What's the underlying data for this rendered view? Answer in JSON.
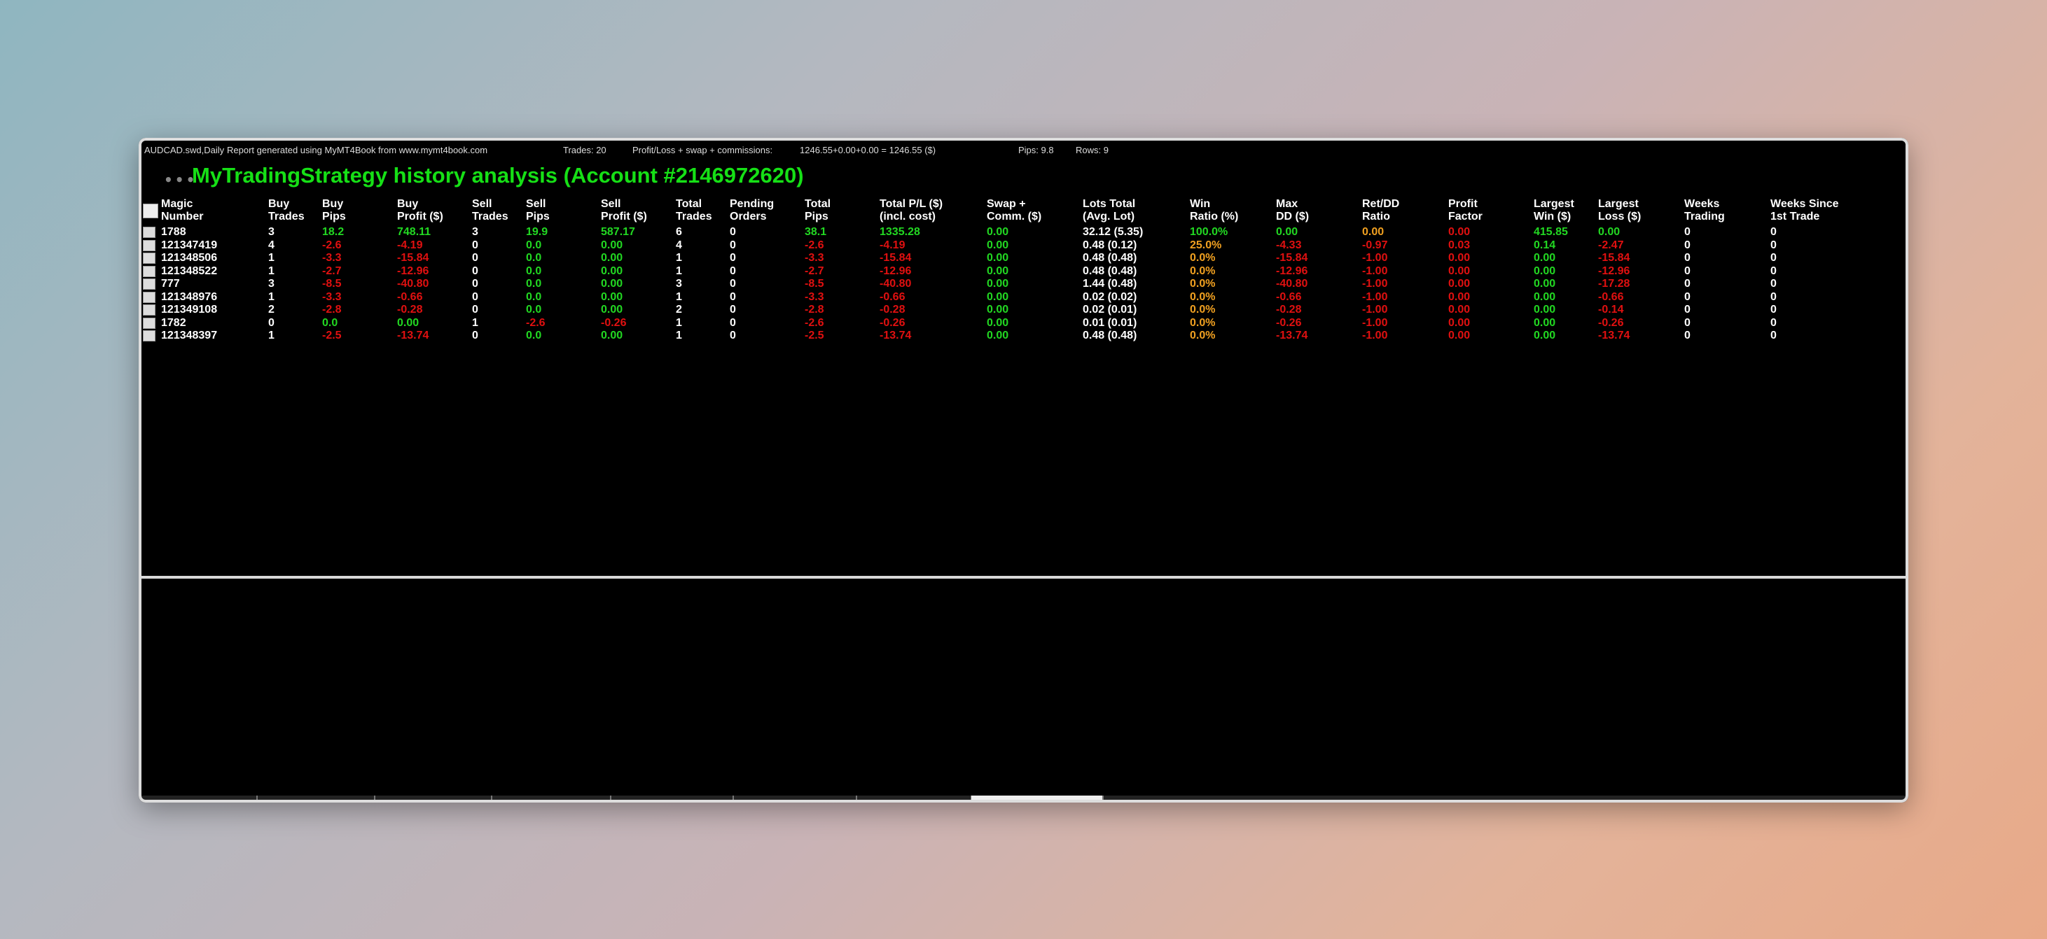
{
  "info": {
    "symbol": "AUDCAD.swd,Daily",
    "report": "Report generated using MyMT4Book from www.mymt4book.com",
    "trades": "Trades: 20",
    "pl_label": "Profit/Loss + swap + commissions:",
    "pl_value": "1246.55+0.00+0.00 = 1246.55 ($)",
    "pips": "Pips: 9.8",
    "rows": "Rows: 9"
  },
  "title": "MyTradingStrategy history analysis (Account #2146972620)",
  "dots": "•••",
  "headers": [
    [
      "Magic",
      "Number"
    ],
    [
      "Buy",
      "Trades"
    ],
    [
      "Buy",
      "Pips"
    ],
    [
      "Buy",
      "Profit ($)"
    ],
    [
      "Sell",
      "Trades"
    ],
    [
      "Sell",
      "Pips"
    ],
    [
      "Sell",
      "Profit ($)"
    ],
    [
      "Total",
      "Trades"
    ],
    [
      "Pending",
      "Orders"
    ],
    [
      "Total",
      "Pips"
    ],
    [
      "Total P/L ($)",
      "(incl. cost)"
    ],
    [
      "Swap +",
      "Comm. ($)"
    ],
    [
      "Lots Total",
      "(Avg. Lot)"
    ],
    [
      "Win",
      "Ratio (%)"
    ],
    [
      "Max",
      "DD ($)"
    ],
    [
      "Ret/DD",
      "Ratio"
    ],
    [
      "Profit",
      "Factor"
    ],
    [
      "Largest",
      "Win ($)"
    ],
    [
      "Largest",
      "Loss ($)"
    ],
    [
      "Weeks",
      "Trading"
    ],
    [
      "Weeks Since",
      "1st Trade"
    ]
  ],
  "rows": [
    [
      "1788",
      "3",
      "18.2",
      "748.11",
      "3",
      "19.9",
      "587.17",
      "6",
      "0",
      "38.1",
      "1335.28",
      "0.00",
      "32.12 (5.35)",
      "100.0%",
      "0.00",
      "0.00",
      "0.00",
      "415.85",
      "0.00",
      "0",
      "0"
    ],
    [
      "121347419",
      "4",
      "-2.6",
      "-4.19",
      "0",
      "0.0",
      "0.00",
      "4",
      "0",
      "-2.6",
      "-4.19",
      "0.00",
      "0.48 (0.12)",
      "25.0%",
      "-4.33",
      "-0.97",
      "0.03",
      "0.14",
      "-2.47",
      "0",
      "0"
    ],
    [
      "121348506",
      "1",
      "-3.3",
      "-15.84",
      "0",
      "0.0",
      "0.00",
      "1",
      "0",
      "-3.3",
      "-15.84",
      "0.00",
      "0.48 (0.48)",
      "0.0%",
      "-15.84",
      "-1.00",
      "0.00",
      "0.00",
      "-15.84",
      "0",
      "0"
    ],
    [
      "121348522",
      "1",
      "-2.7",
      "-12.96",
      "0",
      "0.0",
      "0.00",
      "1",
      "0",
      "-2.7",
      "-12.96",
      "0.00",
      "0.48 (0.48)",
      "0.0%",
      "-12.96",
      "-1.00",
      "0.00",
      "0.00",
      "-12.96",
      "0",
      "0"
    ],
    [
      "777",
      "3",
      "-8.5",
      "-40.80",
      "0",
      "0.0",
      "0.00",
      "3",
      "0",
      "-8.5",
      "-40.80",
      "0.00",
      "1.44 (0.48)",
      "0.0%",
      "-40.80",
      "-1.00",
      "0.00",
      "0.00",
      "-17.28",
      "0",
      "0"
    ],
    [
      "121348976",
      "1",
      "-3.3",
      "-0.66",
      "0",
      "0.0",
      "0.00",
      "1",
      "0",
      "-3.3",
      "-0.66",
      "0.00",
      "0.02 (0.02)",
      "0.0%",
      "-0.66",
      "-1.00",
      "0.00",
      "0.00",
      "-0.66",
      "0",
      "0"
    ],
    [
      "121349108",
      "2",
      "-2.8",
      "-0.28",
      "0",
      "0.0",
      "0.00",
      "2",
      "0",
      "-2.8",
      "-0.28",
      "0.00",
      "0.02 (0.01)",
      "0.0%",
      "-0.28",
      "-1.00",
      "0.00",
      "0.00",
      "-0.14",
      "0",
      "0"
    ],
    [
      "1782",
      "0",
      "0.0",
      "0.00",
      "1",
      "-2.6",
      "-0.26",
      "1",
      "0",
      "-2.6",
      "-0.26",
      "0.00",
      "0.01 (0.01)",
      "0.0%",
      "-0.26",
      "-1.00",
      "0.00",
      "0.00",
      "-0.26",
      "0",
      "0"
    ],
    [
      "121348397",
      "1",
      "-2.5",
      "-13.74",
      "0",
      "0.0",
      "0.00",
      "1",
      "0",
      "-2.5",
      "-13.74",
      "0.00",
      "0.48 (0.48)",
      "0.0%",
      "-13.74",
      "-1.00",
      "0.00",
      "0.00",
      "-13.74",
      "0",
      "0"
    ]
  ],
  "colors": {
    "positive": "#22d822",
    "negative": "#e01010",
    "warning": "#f0a020",
    "neutral": "#ffffff",
    "title": "#16e016"
  }
}
